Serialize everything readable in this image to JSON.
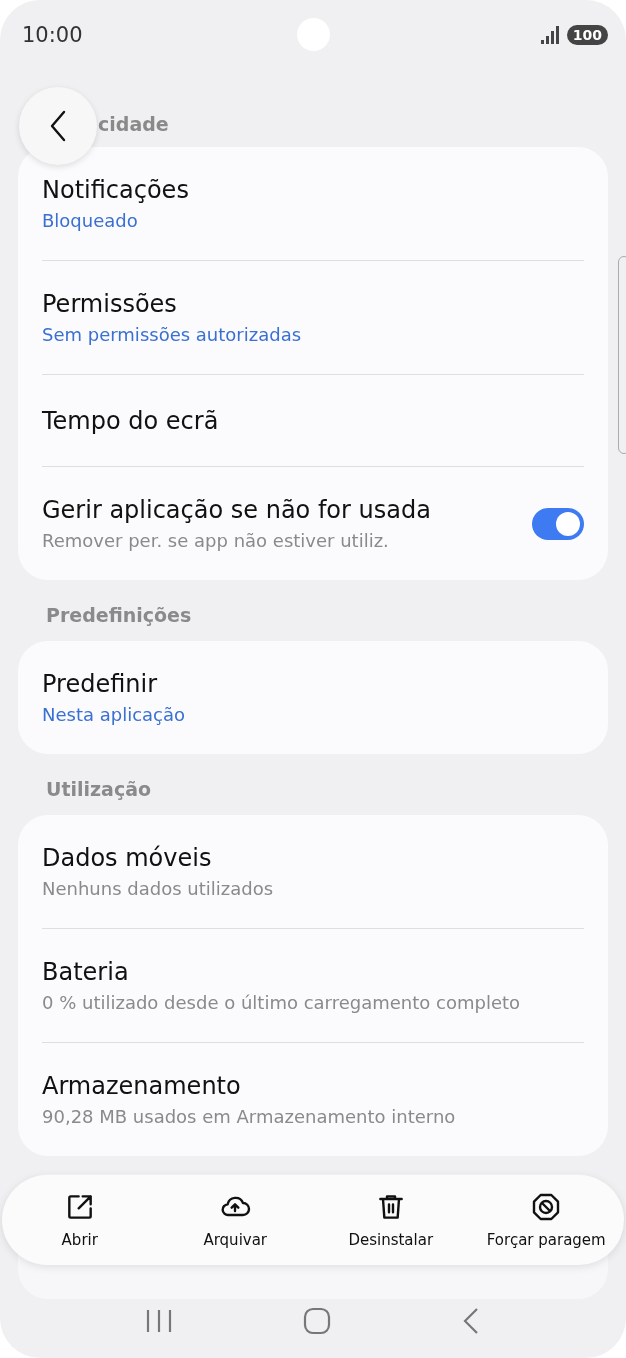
{
  "status_bar": {
    "time": "10:00",
    "battery": "100"
  },
  "header": {
    "title": "cidade"
  },
  "sections": [
    {
      "rows": [
        {
          "kind": "link",
          "title": "Notificações",
          "subtitle": "Bloqueado",
          "accent": true
        },
        {
          "kind": "link",
          "title": "Permissões",
          "subtitle": "Sem permissões autorizadas",
          "accent": true
        },
        {
          "kind": "link",
          "title": "Tempo do ecrã"
        },
        {
          "kind": "switch",
          "title": "Gerir aplicação se não for usada",
          "subtitle": "Remover per. se app não estiver utiliz.",
          "on": true
        }
      ]
    },
    {
      "label": "Predefinições",
      "rows": [
        {
          "kind": "link",
          "title": "Predefinir",
          "subtitle": "Nesta aplicação",
          "accent": true
        }
      ]
    },
    {
      "label": "Utilização",
      "rows": [
        {
          "kind": "link",
          "title": "Dados móveis",
          "subtitle": "Nenhuns dados utilizados",
          "accent": false
        },
        {
          "kind": "link",
          "title": "Bateria",
          "subtitle": "0 % utilizado desde o último carregamento completo",
          "accent": false
        },
        {
          "kind": "link",
          "title": "Armazenamento",
          "subtitle": "90,28 MB usados em Armazenamento interno",
          "accent": false
        }
      ]
    }
  ],
  "partial_card": {
    "kind": "card"
  },
  "actions": [
    {
      "kind": "open",
      "label": "Abrir"
    },
    {
      "kind": "archive",
      "label": "Arquivar"
    },
    {
      "kind": "uninstall",
      "label": "Desinstalar"
    },
    {
      "kind": "stop",
      "label": "Forçar paragem"
    }
  ]
}
